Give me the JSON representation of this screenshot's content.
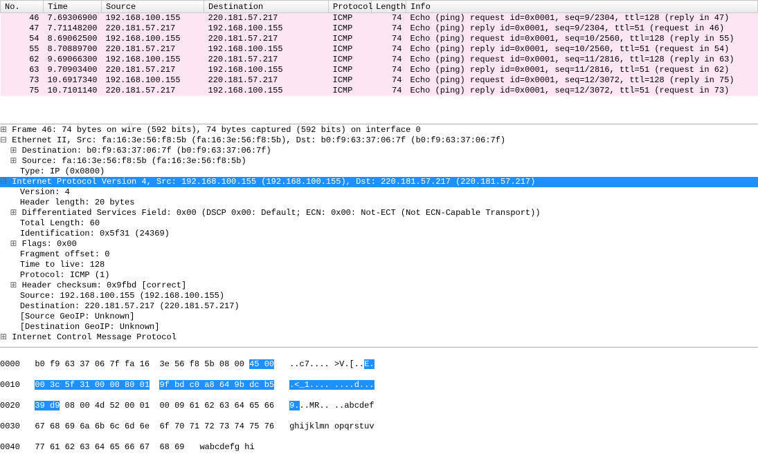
{
  "columns": {
    "no": "No.",
    "time": "Time",
    "source": "Source",
    "destination": "Destination",
    "protocol": "Protocol",
    "length": "Length",
    "info": "Info"
  },
  "packets": [
    {
      "no": "46",
      "time": "7.69306900",
      "src": "192.168.100.155",
      "dst": "220.181.57.217",
      "proto": "ICMP",
      "len": "74",
      "info": "Echo (ping) request  id=0x0001, seq=9/2304, ttl=128 (reply in 47)"
    },
    {
      "no": "47",
      "time": "7.71148200",
      "src": "220.181.57.217",
      "dst": "192.168.100.155",
      "proto": "ICMP",
      "len": "74",
      "info": "Echo (ping) reply    id=0x0001, seq=9/2304, ttl=51 (request in 46)"
    },
    {
      "no": "54",
      "time": "8.69062500",
      "src": "192.168.100.155",
      "dst": "220.181.57.217",
      "proto": "ICMP",
      "len": "74",
      "info": "Echo (ping) request  id=0x0001, seq=10/2560, ttl=128 (reply in 55)"
    },
    {
      "no": "55",
      "time": "8.70889700",
      "src": "220.181.57.217",
      "dst": "192.168.100.155",
      "proto": "ICMP",
      "len": "74",
      "info": "Echo (ping) reply    id=0x0001, seq=10/2560, ttl=51 (request in 54)"
    },
    {
      "no": "62",
      "time": "9.69066300",
      "src": "192.168.100.155",
      "dst": "220.181.57.217",
      "proto": "ICMP",
      "len": "74",
      "info": "Echo (ping) request  id=0x0001, seq=11/2816, ttl=128 (reply in 63)"
    },
    {
      "no": "63",
      "time": "9.70903400",
      "src": "220.181.57.217",
      "dst": "192.168.100.155",
      "proto": "ICMP",
      "len": "74",
      "info": "Echo (ping) reply    id=0x0001, seq=11/2816, ttl=51 (request in 62)"
    },
    {
      "no": "73",
      "time": "10.6917340",
      "src": "192.168.100.155",
      "dst": "220.181.57.217",
      "proto": "ICMP",
      "len": "74",
      "info": "Echo (ping) request  id=0x0001, seq=12/3072, ttl=128 (reply in 75)"
    },
    {
      "no": "75",
      "time": "10.7101140",
      "src": "220.181.57.217",
      "dst": "192.168.100.155",
      "proto": "ICMP",
      "len": "74",
      "info": "Echo (ping) reply    id=0x0001, seq=12/3072, ttl=51 (request in 73)"
    }
  ],
  "details": {
    "frame": "Frame 46: 74 bytes on wire (592 bits), 74 bytes captured (592 bits) on interface 0",
    "eth": "Ethernet II, Src: fa:16:3e:56:f8:5b (fa:16:3e:56:f8:5b), Dst: b0:f9:63:37:06:7f (b0:f9:63:37:06:7f)",
    "eth_dst": "Destination: b0:f9:63:37:06:7f (b0:f9:63:37:06:7f)",
    "eth_src": "Source: fa:16:3e:56:f8:5b (fa:16:3e:56:f8:5b)",
    "eth_type": "Type: IP (0x0800)",
    "ip": "Internet Protocol Version 4, Src: 192.168.100.155 (192.168.100.155), Dst: 220.181.57.217 (220.181.57.217)",
    "ip_ver": "Version: 4",
    "ip_hlen": "Header length: 20 bytes",
    "ip_dscp": "Differentiated Services Field: 0x00 (DSCP 0x00: Default; ECN: 0x00: Not-ECT (Not ECN-Capable Transport))",
    "ip_tlen": "Total Length: 60",
    "ip_id": "Identification: 0x5f31 (24369)",
    "ip_flags": "Flags: 0x00",
    "ip_frag": "Fragment offset: 0",
    "ip_ttl": "Time to live: 128",
    "ip_proto": "Protocol: ICMP (1)",
    "ip_chk": "Header checksum: 0x9fbd [correct]",
    "ip_src": "Source: 192.168.100.155 (192.168.100.155)",
    "ip_dst": "Destination: 220.181.57.217 (220.181.57.217)",
    "ip_sgip": "[Source GeoIP: Unknown]",
    "ip_dgip": "[Destination GeoIP: Unknown]",
    "icmp": "Internet Control Message Protocol"
  },
  "hex": {
    "r0": {
      "off": "0000",
      "b1": "b0 f9 63 37 06 7f fa 16",
      "b2": "3e 56 f8 5b 08 00 ",
      "hb": "45 00",
      "a": "..c7.... >V.[..",
      "as": "E."
    },
    "r1": {
      "off": "0010",
      "hb1": "00 3c 5f 31 00 00 80 01",
      "hb2": "9f bd c0 a8 64 9b dc b5",
      "as1": ".<_1.... ....d...",
      "a1": ""
    },
    "r2": {
      "off": "0020",
      "hb1": "39 d9",
      "b1": " 08 00 4d 52 00 01",
      "b2": "00 09 61 62 63 64 65 66",
      "as1": "9.",
      "a1": "..MR.. ..abcdef"
    },
    "r3": {
      "off": "0030",
      "b1": "67 68 69 6a 6b 6c 6d 6e",
      "b2": "6f 70 71 72 73 74 75 76",
      "a": "ghijklmn opqrstuv"
    },
    "r4": {
      "off": "0040",
      "b1": "77 61 62 63 64 65 66 67",
      "b2": "68 69",
      "a": "wabcdefg hi"
    }
  },
  "exp": {
    "plus": "⊞",
    "minus": "⊟"
  }
}
